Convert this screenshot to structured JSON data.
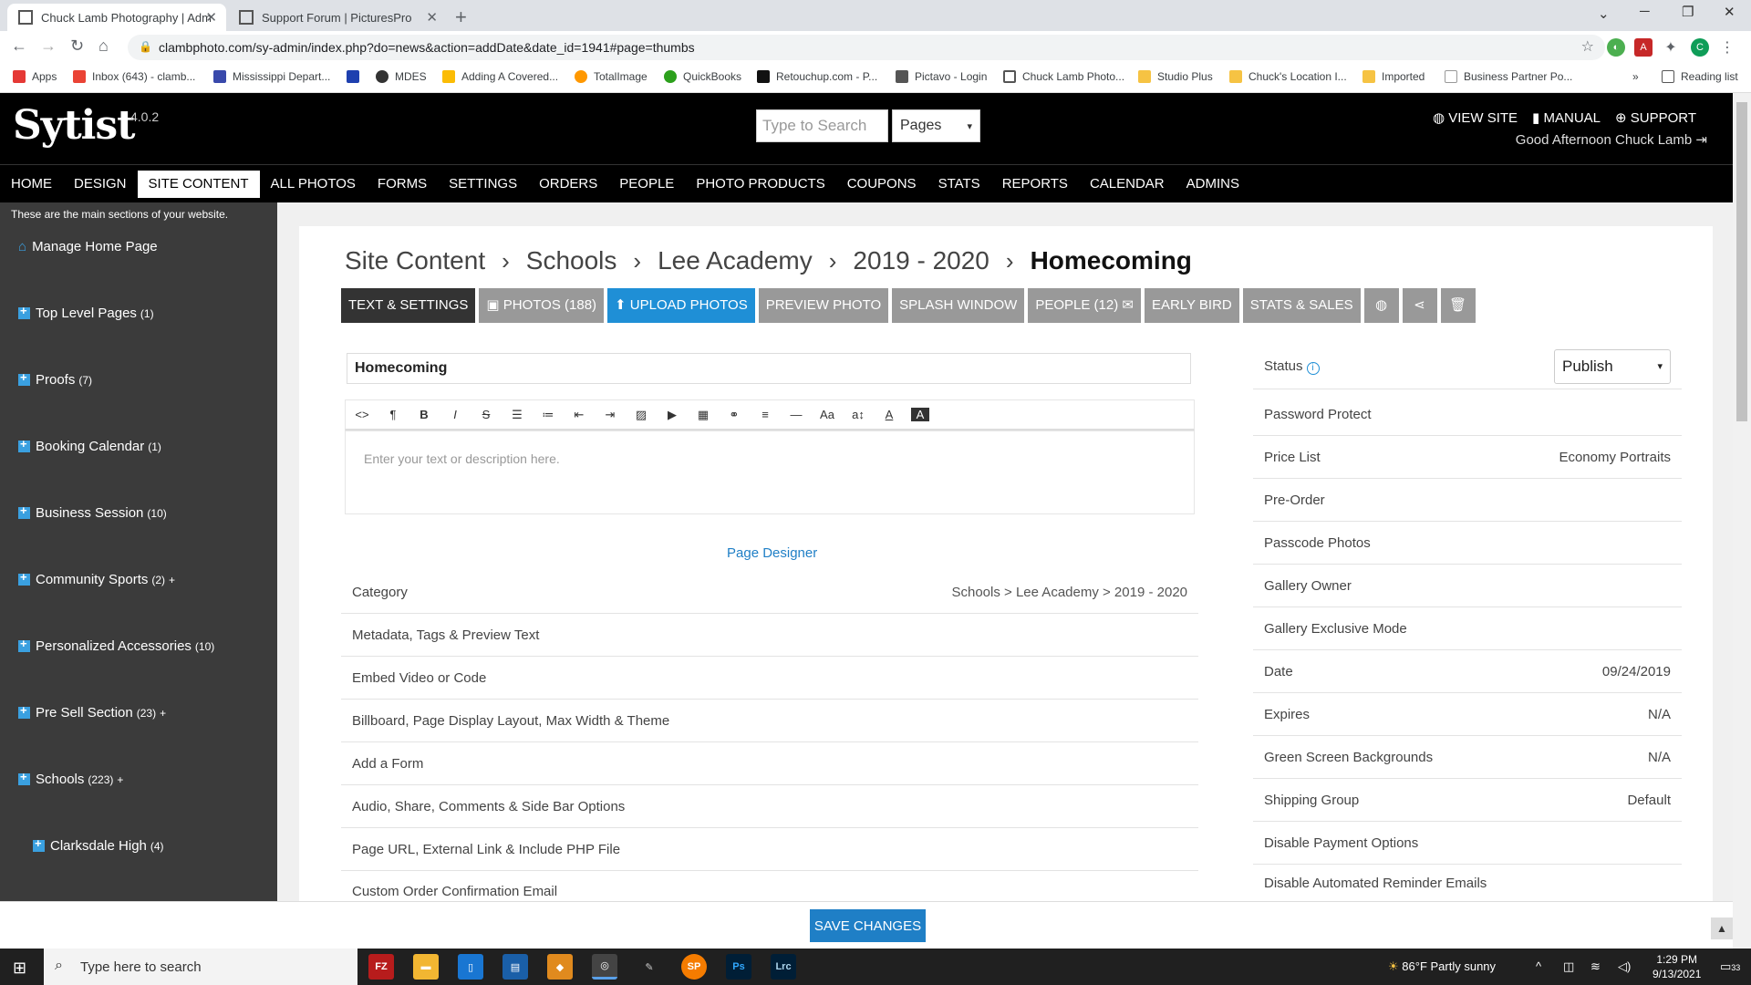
{
  "browser": {
    "tabs": [
      {
        "title": "Chuck Lamb Photography | Adm"
      },
      {
        "title": "Support Forum | PicturesPro"
      }
    ],
    "url": "clambphoto.com/sy-admin/index.php?do=news&action=addDate&date_id=1941#page=thumbs",
    "bookmarks": [
      "Apps",
      "Inbox (643) - clamb...",
      "Mississippi Depart...",
      "MDES",
      "Adding A Covered...",
      "TotalImage",
      "QuickBooks",
      "Retouchup.com - P...",
      "Pictavo - Login",
      "Chuck Lamb Photo...",
      "Studio Plus",
      "Chuck's Location I...",
      "Imported",
      "Business Partner Po..."
    ],
    "bookmarks_more": "»",
    "reading_list": "Reading list",
    "profile_initial": "C"
  },
  "header": {
    "logo": "Sytist",
    "version": "4.0.2",
    "search_placeholder": "Type to Search",
    "search_scope": "Pages",
    "view_site": "VIEW SITE",
    "manual": "MANUAL",
    "support": "SUPPORT",
    "greeting": "Good Afternoon Chuck Lamb"
  },
  "nav": [
    "HOME",
    "DESIGN",
    "SITE CONTENT",
    "ALL PHOTOS",
    "FORMS",
    "SETTINGS",
    "ORDERS",
    "PEOPLE",
    "PHOTO PRODUCTS",
    "COUPONS",
    "STATS",
    "REPORTS",
    "CALENDAR",
    "ADMINS"
  ],
  "sidebar": {
    "intro": "These are the main sections of your website.",
    "items": [
      {
        "label": "Manage Home Page",
        "count": "",
        "plus": ""
      },
      {
        "label": "Top Level Pages",
        "count": "(1)",
        "plus": ""
      },
      {
        "label": "Proofs",
        "count": "(7)",
        "plus": ""
      },
      {
        "label": "Booking Calendar",
        "count": "(1)",
        "plus": ""
      },
      {
        "label": "Business Session",
        "count": "(10)",
        "plus": ""
      },
      {
        "label": "Community Sports",
        "count": "(2)",
        "plus": "+"
      },
      {
        "label": "Personalized Accessories",
        "count": "(10)",
        "plus": ""
      },
      {
        "label": "Pre Sell Section",
        "count": "(23)",
        "plus": "+"
      },
      {
        "label": "Schools",
        "count": "(223)",
        "plus": "+"
      },
      {
        "label": "Clarksdale High",
        "count": "(4)",
        "plus": ""
      }
    ]
  },
  "breadcrumb": [
    "Site Content",
    "Schools",
    "Lee Academy",
    "2019 - 2020"
  ],
  "breadcrumb_current": "Homecoming",
  "buttons": {
    "text_settings": "TEXT & SETTINGS",
    "photos": "PHOTOS (188)",
    "upload": "UPLOAD PHOTOS",
    "preview": "PREVIEW PHOTO",
    "splash": "SPLASH WINDOW",
    "people": "PEOPLE (12)",
    "early_bird": "EARLY BIRD",
    "stats_sales": "STATS & SALES"
  },
  "editor": {
    "title": "Homecoming",
    "placeholder": "Enter your text or description here.",
    "page_designer": "Page Designer"
  },
  "options": [
    {
      "label": "Category",
      "value": "Schools > Lee Academy > 2019 - 2020"
    },
    {
      "label": "Metadata, Tags & Preview Text",
      "value": ""
    },
    {
      "label": "Embed Video or Code",
      "value": ""
    },
    {
      "label": "Billboard, Page Display Layout, Max Width & Theme",
      "value": ""
    },
    {
      "label": "Add a Form",
      "value": ""
    },
    {
      "label": "Audio, Share, Comments & Side Bar Options",
      "value": ""
    },
    {
      "label": "Page URL, External Link & Include PHP File",
      "value": ""
    },
    {
      "label": "Custom Order Confirmation Email",
      "value": ""
    }
  ],
  "settings": {
    "status_label": "Status",
    "status_value": "Publish",
    "rows": [
      {
        "label": "Password Protect",
        "value": ""
      },
      {
        "label": "Price List",
        "value": "Economy Portraits"
      },
      {
        "label": "Pre-Order",
        "value": ""
      },
      {
        "label": "Passcode Photos",
        "value": ""
      },
      {
        "label": "Gallery Owner",
        "value": ""
      },
      {
        "label": "Gallery Exclusive Mode",
        "value": ""
      },
      {
        "label": "Date",
        "value": "09/24/2019"
      },
      {
        "label": "Expires",
        "value": "N/A"
      },
      {
        "label": "Green Screen Backgrounds",
        "value": "N/A"
      },
      {
        "label": "Shipping Group",
        "value": "Default"
      },
      {
        "label": "Disable Payment Options",
        "value": ""
      },
      {
        "label": "Disable Automated Reminder Emails",
        "value": ""
      }
    ]
  },
  "save_label": "SAVE CHANGES",
  "taskbar": {
    "search_placeholder": "Type here to search",
    "weather": "86°F  Partly sunny",
    "time": "1:29 PM",
    "date": "9/13/2021",
    "notifications": "33"
  },
  "colors": {
    "accent": "#1f7fc6",
    "header_bg": "#000000",
    "sidebar_bg": "#3b3b3b"
  }
}
